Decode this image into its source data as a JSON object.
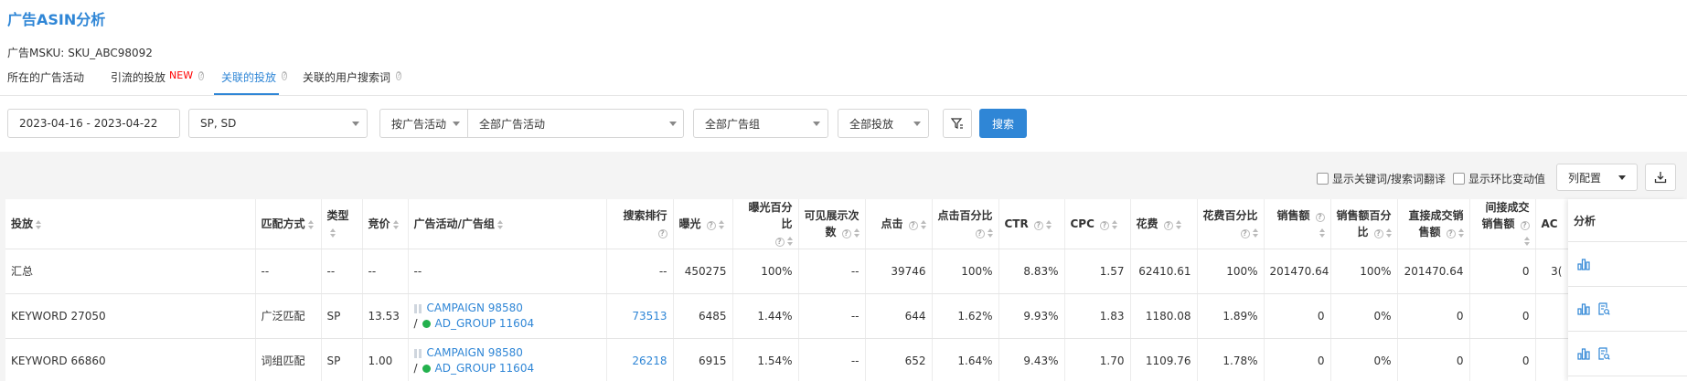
{
  "page": {
    "title": "广告ASIN分析",
    "msku_label": "广告MSKU:",
    "msku_value": "SKU_ABC98092"
  },
  "tabs": [
    {
      "label": "所在的广告活动",
      "active": false
    },
    {
      "label": "引流的投放",
      "badge": "NEW",
      "active": false
    },
    {
      "label": "关联的投放",
      "active": true
    },
    {
      "label": "关联的用户搜索词",
      "active": false
    }
  ],
  "filters": {
    "date_range": "2023-04-16 - 2023-04-22",
    "ad_type": "SP, SD",
    "group_by": "按广告活动",
    "campaign": "全部广告活动",
    "ad_group": "全部广告组",
    "targeting": "全部投放",
    "search_label": "搜索"
  },
  "options": {
    "show_translation": "显示关键词/搜索词翻译",
    "show_change": "显示环比变动值",
    "column_config": "列配置"
  },
  "table": {
    "headers": {
      "targeting": "投放",
      "match_type": "匹配方式",
      "type": "类型",
      "bid": "竞价",
      "campaign_group": "广告活动/广告组",
      "search_rank": "搜索排行",
      "impressions": "曝光",
      "impressions_pct": "曝光百分比",
      "visible_impressions": "可见展示次数",
      "clicks": "点击",
      "clicks_pct": "点击百分比",
      "ctr": "CTR",
      "cpc": "CPC",
      "spend": "花费",
      "spend_pct": "花费百分比",
      "sales": "销售额",
      "sales_pct": "销售额百分比",
      "direct_sales": "直接成交销售额",
      "indirect_sales": "间接成交销售额",
      "acos": "AC",
      "analysis": "分析"
    },
    "summary": {
      "targeting": "汇总",
      "match_type": "--",
      "type": "--",
      "bid": "--",
      "campaign_group": "--",
      "search_rank": "--",
      "impressions": "450275",
      "impressions_pct": "100%",
      "visible_impressions": "--",
      "clicks": "39746",
      "clicks_pct": "100%",
      "ctr": "8.83%",
      "cpc": "1.57",
      "spend": "62410.61",
      "spend_pct": "100%",
      "sales": "201470.64",
      "sales_pct": "100%",
      "direct_sales": "201470.64",
      "indirect_sales": "0",
      "acos": "3("
    },
    "rows": [
      {
        "targeting": "KEYWORD 27050",
        "match_type": "广泛匹配",
        "type": "SP",
        "bid": "13.53",
        "campaign": "CAMPAIGN 98580",
        "ad_group": "AD_GROUP 11604",
        "search_rank": "73513",
        "impressions": "6485",
        "impressions_pct": "1.44%",
        "visible_impressions": "--",
        "clicks": "644",
        "clicks_pct": "1.62%",
        "ctr": "9.93%",
        "cpc": "1.83",
        "spend": "1180.08",
        "spend_pct": "1.89%",
        "sales": "0",
        "sales_pct": "0%",
        "direct_sales": "0",
        "indirect_sales": "0"
      },
      {
        "targeting": "KEYWORD 66860",
        "match_type": "词组匹配",
        "type": "SP",
        "bid": "1.00",
        "campaign": "CAMPAIGN 98580",
        "ad_group": "AD_GROUP 11604",
        "search_rank": "26218",
        "impressions": "6915",
        "impressions_pct": "1.54%",
        "visible_impressions": "--",
        "clicks": "652",
        "clicks_pct": "1.64%",
        "ctr": "9.43%",
        "cpc": "1.70",
        "spend": "1109.76",
        "spend_pct": "1.78%",
        "sales": "0",
        "sales_pct": "0%",
        "direct_sales": "0",
        "indirect_sales": "0"
      }
    ]
  },
  "colors": {
    "accent": "#2f86d6",
    "new_badge": "#ff0000",
    "status_dot": "#23b14d"
  }
}
